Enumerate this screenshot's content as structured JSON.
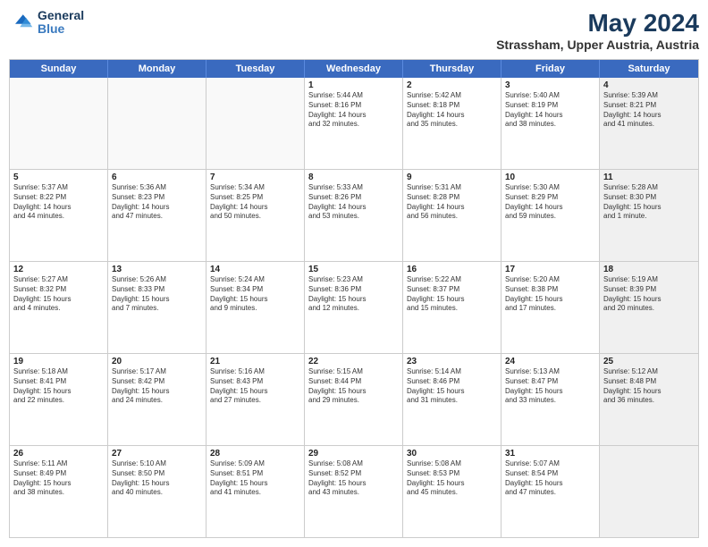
{
  "logo": {
    "line1": "General",
    "line2": "Blue"
  },
  "title": "May 2024",
  "location": "Strassham, Upper Austria, Austria",
  "weekdays": [
    "Sunday",
    "Monday",
    "Tuesday",
    "Wednesday",
    "Thursday",
    "Friday",
    "Saturday"
  ],
  "rows": [
    [
      {
        "day": "",
        "text": "",
        "empty": true
      },
      {
        "day": "",
        "text": "",
        "empty": true
      },
      {
        "day": "",
        "text": "",
        "empty": true
      },
      {
        "day": "1",
        "text": "Sunrise: 5:44 AM\nSunset: 8:16 PM\nDaylight: 14 hours\nand 32 minutes."
      },
      {
        "day": "2",
        "text": "Sunrise: 5:42 AM\nSunset: 8:18 PM\nDaylight: 14 hours\nand 35 minutes."
      },
      {
        "day": "3",
        "text": "Sunrise: 5:40 AM\nSunset: 8:19 PM\nDaylight: 14 hours\nand 38 minutes."
      },
      {
        "day": "4",
        "text": "Sunrise: 5:39 AM\nSunset: 8:21 PM\nDaylight: 14 hours\nand 41 minutes.",
        "shaded": true
      }
    ],
    [
      {
        "day": "5",
        "text": "Sunrise: 5:37 AM\nSunset: 8:22 PM\nDaylight: 14 hours\nand 44 minutes."
      },
      {
        "day": "6",
        "text": "Sunrise: 5:36 AM\nSunset: 8:23 PM\nDaylight: 14 hours\nand 47 minutes."
      },
      {
        "day": "7",
        "text": "Sunrise: 5:34 AM\nSunset: 8:25 PM\nDaylight: 14 hours\nand 50 minutes."
      },
      {
        "day": "8",
        "text": "Sunrise: 5:33 AM\nSunset: 8:26 PM\nDaylight: 14 hours\nand 53 minutes."
      },
      {
        "day": "9",
        "text": "Sunrise: 5:31 AM\nSunset: 8:28 PM\nDaylight: 14 hours\nand 56 minutes."
      },
      {
        "day": "10",
        "text": "Sunrise: 5:30 AM\nSunset: 8:29 PM\nDaylight: 14 hours\nand 59 minutes."
      },
      {
        "day": "11",
        "text": "Sunrise: 5:28 AM\nSunset: 8:30 PM\nDaylight: 15 hours\nand 1 minute.",
        "shaded": true
      }
    ],
    [
      {
        "day": "12",
        "text": "Sunrise: 5:27 AM\nSunset: 8:32 PM\nDaylight: 15 hours\nand 4 minutes."
      },
      {
        "day": "13",
        "text": "Sunrise: 5:26 AM\nSunset: 8:33 PM\nDaylight: 15 hours\nand 7 minutes."
      },
      {
        "day": "14",
        "text": "Sunrise: 5:24 AM\nSunset: 8:34 PM\nDaylight: 15 hours\nand 9 minutes."
      },
      {
        "day": "15",
        "text": "Sunrise: 5:23 AM\nSunset: 8:36 PM\nDaylight: 15 hours\nand 12 minutes."
      },
      {
        "day": "16",
        "text": "Sunrise: 5:22 AM\nSunset: 8:37 PM\nDaylight: 15 hours\nand 15 minutes."
      },
      {
        "day": "17",
        "text": "Sunrise: 5:20 AM\nSunset: 8:38 PM\nDaylight: 15 hours\nand 17 minutes."
      },
      {
        "day": "18",
        "text": "Sunrise: 5:19 AM\nSunset: 8:39 PM\nDaylight: 15 hours\nand 20 minutes.",
        "shaded": true
      }
    ],
    [
      {
        "day": "19",
        "text": "Sunrise: 5:18 AM\nSunset: 8:41 PM\nDaylight: 15 hours\nand 22 minutes."
      },
      {
        "day": "20",
        "text": "Sunrise: 5:17 AM\nSunset: 8:42 PM\nDaylight: 15 hours\nand 24 minutes."
      },
      {
        "day": "21",
        "text": "Sunrise: 5:16 AM\nSunset: 8:43 PM\nDaylight: 15 hours\nand 27 minutes."
      },
      {
        "day": "22",
        "text": "Sunrise: 5:15 AM\nSunset: 8:44 PM\nDaylight: 15 hours\nand 29 minutes."
      },
      {
        "day": "23",
        "text": "Sunrise: 5:14 AM\nSunset: 8:46 PM\nDaylight: 15 hours\nand 31 minutes."
      },
      {
        "day": "24",
        "text": "Sunrise: 5:13 AM\nSunset: 8:47 PM\nDaylight: 15 hours\nand 33 minutes."
      },
      {
        "day": "25",
        "text": "Sunrise: 5:12 AM\nSunset: 8:48 PM\nDaylight: 15 hours\nand 36 minutes.",
        "shaded": true
      }
    ],
    [
      {
        "day": "26",
        "text": "Sunrise: 5:11 AM\nSunset: 8:49 PM\nDaylight: 15 hours\nand 38 minutes."
      },
      {
        "day": "27",
        "text": "Sunrise: 5:10 AM\nSunset: 8:50 PM\nDaylight: 15 hours\nand 40 minutes."
      },
      {
        "day": "28",
        "text": "Sunrise: 5:09 AM\nSunset: 8:51 PM\nDaylight: 15 hours\nand 41 minutes."
      },
      {
        "day": "29",
        "text": "Sunrise: 5:08 AM\nSunset: 8:52 PM\nDaylight: 15 hours\nand 43 minutes."
      },
      {
        "day": "30",
        "text": "Sunrise: 5:08 AM\nSunset: 8:53 PM\nDaylight: 15 hours\nand 45 minutes."
      },
      {
        "day": "31",
        "text": "Sunrise: 5:07 AM\nSunset: 8:54 PM\nDaylight: 15 hours\nand 47 minutes."
      },
      {
        "day": "",
        "text": "",
        "empty": true,
        "shaded": true
      }
    ]
  ]
}
